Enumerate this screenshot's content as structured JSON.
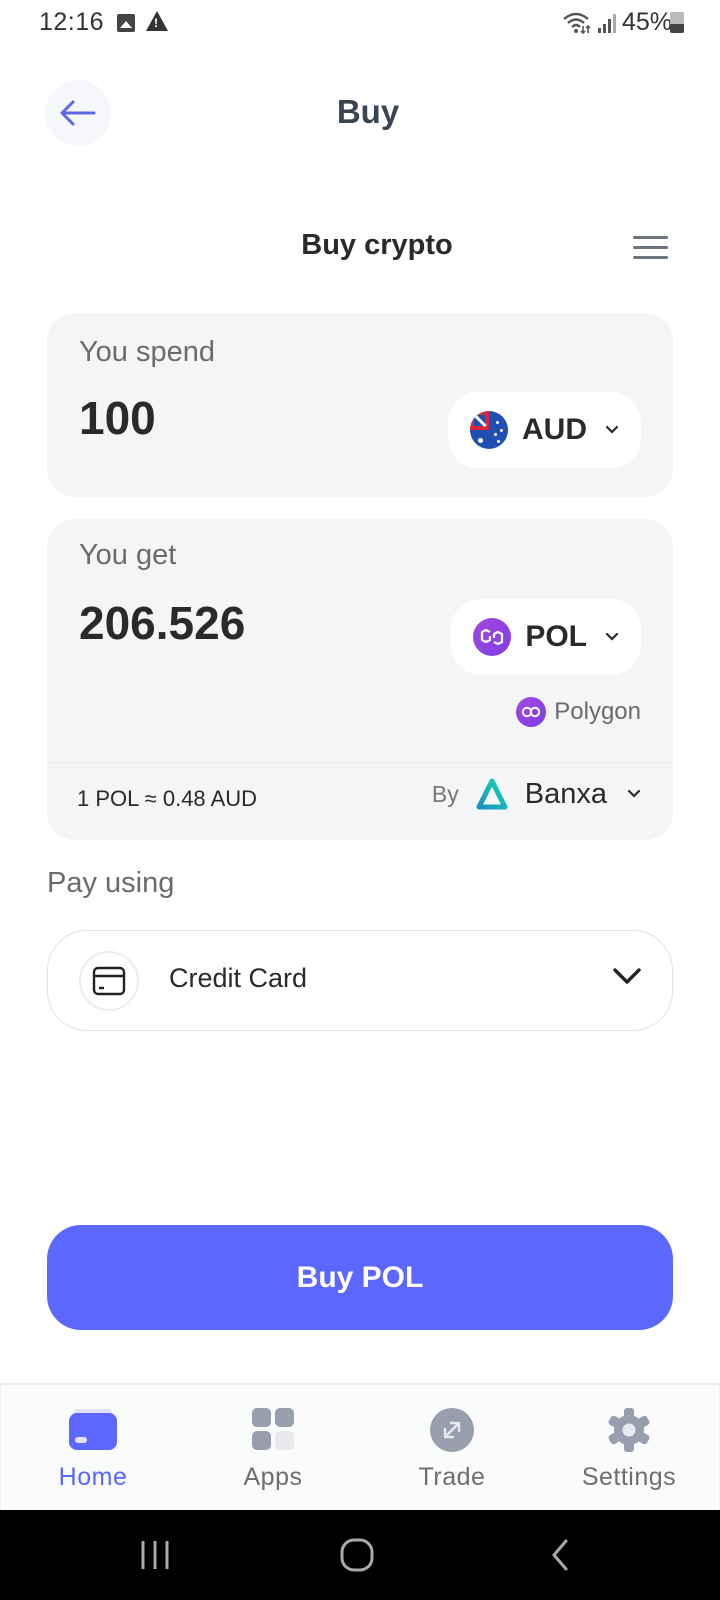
{
  "status_bar": {
    "time": "12:16",
    "battery": "45%",
    "battery_level": 0.45,
    "left_icons": [
      "image-icon",
      "warning-icon"
    ],
    "right_icons": [
      "wifi-icon",
      "signal-icon",
      "battery-icon"
    ]
  },
  "header": {
    "title": "Buy",
    "back_icon": "arrow-left-icon"
  },
  "widget": {
    "title": "Buy crypto",
    "menu_icon": "hamburger-menu-icon"
  },
  "spend": {
    "label": "You spend",
    "amount": "100",
    "currency": "AUD",
    "currency_icon": "australia-flag-icon"
  },
  "get": {
    "label": "You get",
    "amount": "206.526",
    "currency": "POL",
    "currency_icon": "polygon-token-icon",
    "network": "Polygon"
  },
  "quote": {
    "rate": "1 POL ≈ 0.48 AUD",
    "by_label": "By",
    "provider": "Banxa"
  },
  "payment": {
    "label": "Pay using",
    "method": "Credit Card",
    "method_icon": "credit-card-icon"
  },
  "action": {
    "buy_label": "Buy POL"
  },
  "bottom_nav": {
    "items": [
      {
        "label": "Home",
        "icon": "wallet-icon",
        "active": true
      },
      {
        "label": "Apps",
        "icon": "apps-grid-icon",
        "active": false
      },
      {
        "label": "Trade",
        "icon": "trade-arrows-icon",
        "active": false
      },
      {
        "label": "Settings",
        "icon": "gear-icon",
        "active": false
      }
    ]
  },
  "colors": {
    "accent": "#5b67ff",
    "card_bg": "#f4f5f7",
    "title_text": "#3a4554",
    "muted_text": "#6b6b6b",
    "nav_icon_inactive": "#979fae",
    "polygon_purple": "#8247e5",
    "banxa_teal": "#17c9b4"
  }
}
